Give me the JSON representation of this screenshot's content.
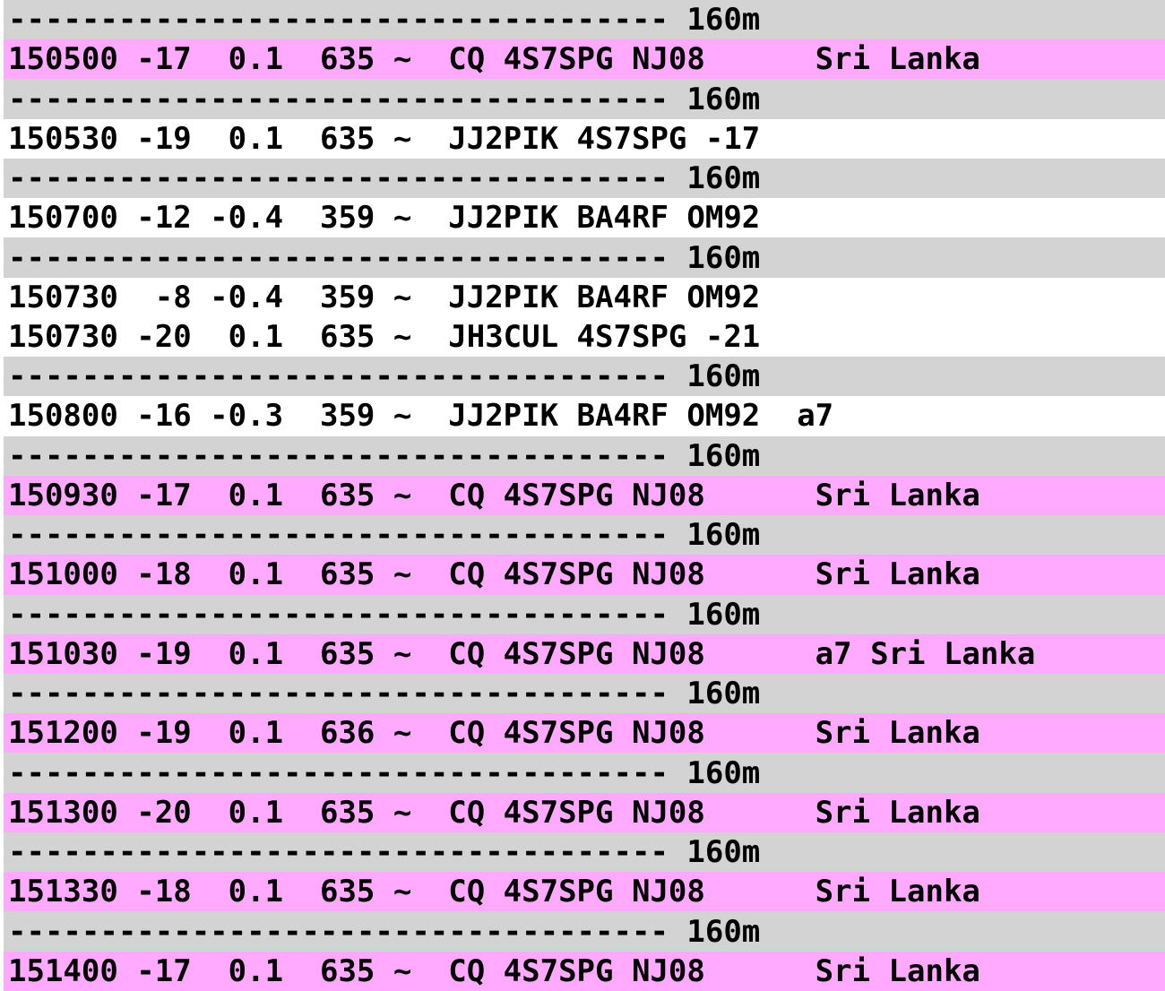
{
  "colors": {
    "highlight_pink": "#ffaaff",
    "separator_gray": "#d3d3d3",
    "row_white": "#ffffff",
    "text_black": "#000000"
  },
  "band_label": "160m",
  "rows": [
    {
      "type": "separator",
      "band": "160m",
      "text": "------------------------------------ 160m"
    },
    {
      "type": "decode",
      "highlight": true,
      "utc": "150500",
      "snr": "-17",
      "dt": "0.1",
      "freq": "635",
      "mode": "~",
      "message": "CQ 4S7SPG NJ08",
      "info": "Sri Lanka",
      "text": "150500 -17  0.1  635 ~  CQ 4S7SPG NJ08      Sri Lanka"
    },
    {
      "type": "separator",
      "band": "160m",
      "text": "------------------------------------ 160m"
    },
    {
      "type": "decode",
      "highlight": false,
      "utc": "150530",
      "snr": "-19",
      "dt": "0.1",
      "freq": "635",
      "mode": "~",
      "message": "JJ2PIK 4S7SPG -17",
      "info": "",
      "text": "150530 -19  0.1  635 ~  JJ2PIK 4S7SPG -17"
    },
    {
      "type": "separator",
      "band": "160m",
      "text": "------------------------------------ 160m"
    },
    {
      "type": "decode",
      "highlight": false,
      "utc": "150700",
      "snr": "-12",
      "dt": "-0.4",
      "freq": "359",
      "mode": "~",
      "message": "JJ2PIK BA4RF OM92",
      "info": "",
      "text": "150700 -12 -0.4  359 ~  JJ2PIK BA4RF OM92"
    },
    {
      "type": "separator",
      "band": "160m",
      "text": "------------------------------------ 160m"
    },
    {
      "type": "decode",
      "highlight": false,
      "utc": "150730",
      "snr": "-8",
      "dt": "-0.4",
      "freq": "359",
      "mode": "~",
      "message": "JJ2PIK BA4RF OM92",
      "info": "",
      "text": "150730  -8 -0.4  359 ~  JJ2PIK BA4RF OM92"
    },
    {
      "type": "decode",
      "highlight": false,
      "utc": "150730",
      "snr": "-20",
      "dt": "0.1",
      "freq": "635",
      "mode": "~",
      "message": "JH3CUL 4S7SPG -21",
      "info": "",
      "text": "150730 -20  0.1  635 ~  JH3CUL 4S7SPG -21"
    },
    {
      "type": "separator",
      "band": "160m",
      "text": "------------------------------------ 160m"
    },
    {
      "type": "decode",
      "highlight": false,
      "utc": "150800",
      "snr": "-16",
      "dt": "-0.3",
      "freq": "359",
      "mode": "~",
      "message": "JJ2PIK BA4RF OM92",
      "info": "a7",
      "text": "150800 -16 -0.3  359 ~  JJ2PIK BA4RF OM92  a7"
    },
    {
      "type": "separator",
      "band": "160m",
      "text": "------------------------------------ 160m"
    },
    {
      "type": "decode",
      "highlight": true,
      "utc": "150930",
      "snr": "-17",
      "dt": "0.1",
      "freq": "635",
      "mode": "~",
      "message": "CQ 4S7SPG NJ08",
      "info": "Sri Lanka",
      "text": "150930 -17  0.1  635 ~  CQ 4S7SPG NJ08      Sri Lanka"
    },
    {
      "type": "separator",
      "band": "160m",
      "text": "------------------------------------ 160m"
    },
    {
      "type": "decode",
      "highlight": true,
      "utc": "151000",
      "snr": "-18",
      "dt": "0.1",
      "freq": "635",
      "mode": "~",
      "message": "CQ 4S7SPG NJ08",
      "info": "Sri Lanka",
      "text": "151000 -18  0.1  635 ~  CQ 4S7SPG NJ08      Sri Lanka"
    },
    {
      "type": "separator",
      "band": "160m",
      "text": "------------------------------------ 160m"
    },
    {
      "type": "decode",
      "highlight": true,
      "utc": "151030",
      "snr": "-19",
      "dt": "0.1",
      "freq": "635",
      "mode": "~",
      "message": "CQ 4S7SPG NJ08",
      "info": "a7 Sri Lanka",
      "text": "151030 -19  0.1  635 ~  CQ 4S7SPG NJ08      a7 Sri Lanka"
    },
    {
      "type": "separator",
      "band": "160m",
      "text": "------------------------------------ 160m"
    },
    {
      "type": "decode",
      "highlight": true,
      "utc": "151200",
      "snr": "-19",
      "dt": "0.1",
      "freq": "636",
      "mode": "~",
      "message": "CQ 4S7SPG NJ08",
      "info": "Sri Lanka",
      "text": "151200 -19  0.1  636 ~  CQ 4S7SPG NJ08      Sri Lanka"
    },
    {
      "type": "separator",
      "band": "160m",
      "text": "------------------------------------ 160m"
    },
    {
      "type": "decode",
      "highlight": true,
      "utc": "151300",
      "snr": "-20",
      "dt": "0.1",
      "freq": "635",
      "mode": "~",
      "message": "CQ 4S7SPG NJ08",
      "info": "Sri Lanka",
      "text": "151300 -20  0.1  635 ~  CQ 4S7SPG NJ08      Sri Lanka"
    },
    {
      "type": "separator",
      "band": "160m",
      "text": "------------------------------------ 160m"
    },
    {
      "type": "decode",
      "highlight": true,
      "utc": "151330",
      "snr": "-18",
      "dt": "0.1",
      "freq": "635",
      "mode": "~",
      "message": "CQ 4S7SPG NJ08",
      "info": "Sri Lanka",
      "text": "151330 -18  0.1  635 ~  CQ 4S7SPG NJ08      Sri Lanka"
    },
    {
      "type": "separator",
      "band": "160m",
      "text": "------------------------------------ 160m"
    },
    {
      "type": "decode",
      "highlight": true,
      "utc": "151400",
      "snr": "-17",
      "dt": "0.1",
      "freq": "635",
      "mode": "~",
      "message": "CQ 4S7SPG NJ08",
      "info": "Sri Lanka",
      "text": "151400 -17  0.1  635 ~  CQ 4S7SPG NJ08      Sri Lanka"
    }
  ]
}
